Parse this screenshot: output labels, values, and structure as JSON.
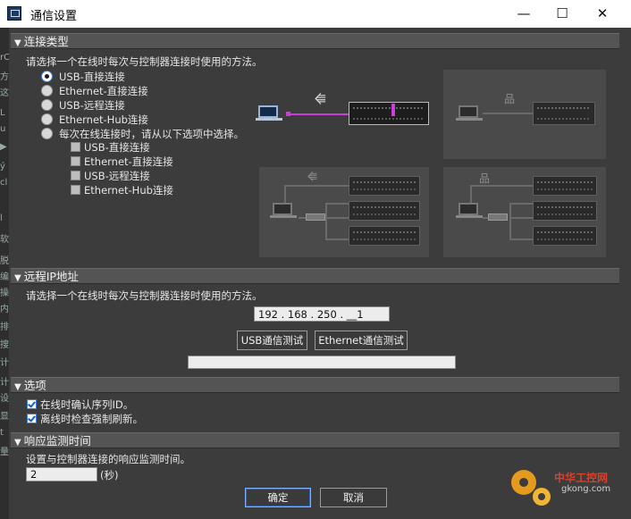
{
  "window": {
    "title": "通信设置",
    "minimize": "—",
    "maximize": "☐",
    "close": "✕"
  },
  "sections": {
    "connection_type": {
      "header": "连接类型",
      "description": "请选择一个在线时每次与控制器连接时使用的方法。",
      "options": [
        {
          "label": "USB-直接连接",
          "selected": true
        },
        {
          "label": "Ethernet-直接连接",
          "selected": false
        },
        {
          "label": "USB-远程连接",
          "selected": false
        },
        {
          "label": "Ethernet-Hub连接",
          "selected": false
        },
        {
          "label": "每次在线连接时，请从以下选项中选择。",
          "selected": false
        }
      ],
      "sub_options": [
        {
          "label": "USB-直接连接",
          "checked": false
        },
        {
          "label": "Ethernet-直接连接",
          "checked": false
        },
        {
          "label": "USB-远程连接",
          "checked": false
        },
        {
          "label": "Ethernet-Hub连接",
          "checked": false
        }
      ]
    },
    "remote_ip": {
      "header": "远程IP地址",
      "description": "请选择一个在线时每次与控制器连接时使用的方法。",
      "ip_value": "192 . 168 . 250 . __1",
      "usb_test_label": "USB通信测试",
      "ethernet_test_label": "Ethernet通信测试",
      "progress": 0
    },
    "options": {
      "header": "选项",
      "items": [
        {
          "label": "在线时确认序列ID。",
          "checked": true
        },
        {
          "label": "离线时检查强制刷新。",
          "checked": true
        }
      ]
    },
    "response_monitor": {
      "header": "响应监测时间",
      "description": "设置与控制器连接的响应监测时间。",
      "value": "2",
      "unit": "(秒)"
    }
  },
  "footer": {
    "ok_label": "确定",
    "cancel_label": "取消"
  },
  "watermark": {
    "line1": "中华工控网",
    "line2": "gkong.com"
  },
  "background_app_fragments": [
    "rC",
    "方",
    "这",
    "L",
    "u",
    "▶",
    "ý",
    "cl",
    "l",
    "软",
    "脱",
    "编",
    "操",
    "内",
    "排",
    "搜",
    "计",
    "计",
    "设",
    "显",
    "t",
    "量"
  ],
  "colors": {
    "accent": "#3c7fd6",
    "usb_link": "#c83fd6",
    "dialog_bg": "#3c3c3c",
    "section_bg": "#545454"
  },
  "icons": {
    "usb": "usb-icon",
    "network": "network-icon"
  }
}
